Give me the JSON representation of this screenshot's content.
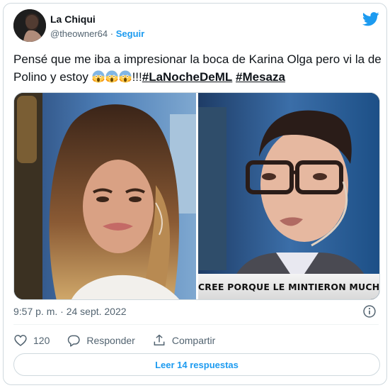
{
  "tweet": {
    "author_name": "La Chiqui",
    "author_handle": "@theowner64",
    "separator": "·",
    "follow_label": "Seguir",
    "text_before": "Pensé que me iba a impresionar la boca de Karina Olga pero vi la de Polino y estoy ",
    "emoji_count": 3,
    "emoji_icon": "face-screaming-in-fear-icon",
    "text_exclaim": "!!!",
    "hashtag_1": "#LaNocheDeML",
    "hashtag_2": "#Mesaza",
    "media": {
      "chyron_text": "SCREE PORQUE LE MINTIERON MUCHO"
    },
    "timestamp": "9:57 p. m. · 24 sept. 2022",
    "likes_count": "120",
    "reply_label": "Responder",
    "share_label": "Compartir",
    "read_replies_label": "Leer 14 respuestas"
  },
  "colors": {
    "accent": "#1d9bf0",
    "text": "#0f1419",
    "secondary": "#536471",
    "border": "#cfd9de"
  }
}
